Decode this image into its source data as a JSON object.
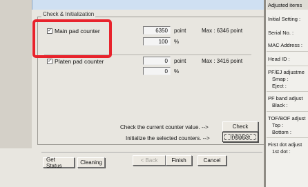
{
  "group": {
    "title": "Check & Initialization"
  },
  "rows": [
    {
      "label": "Main pad counter",
      "checked": true,
      "value": "6350",
      "unit": "point",
      "max": "Max : 6346 point",
      "percent": "100",
      "percent_unit": "%"
    },
    {
      "label": "Platen pad counter",
      "checked": true,
      "value": "0",
      "unit": "point",
      "max": "Max : 3416 point",
      "percent": "0",
      "percent_unit": "%"
    }
  ],
  "actions": {
    "check_prompt": "Check the current counter value. -->",
    "check_label": "Check",
    "init_prompt": "Initialize the selected counters. -->",
    "init_label": "Initialize"
  },
  "footer": {
    "get_status": "Get Status",
    "cleaning": "Cleaning",
    "back": "< Back",
    "finish": "Finish",
    "cancel": "Cancel"
  },
  "right_panel": {
    "items": [
      "Adjusted items",
      "Initial Setting :",
      "Serial No. :",
      "MAC Address :",
      "Head ID :",
      "PF/EJ adjustme",
      "Smap :",
      "Eject :",
      "PF band adjust",
      "Black :",
      "TOF/BOF adjust",
      "Top :",
      "Bottom :",
      "First dot adjust",
      "1st dot :"
    ]
  },
  "colors": {
    "highlight": "#e8232c",
    "dialog_bg": "#e8e6e0"
  }
}
